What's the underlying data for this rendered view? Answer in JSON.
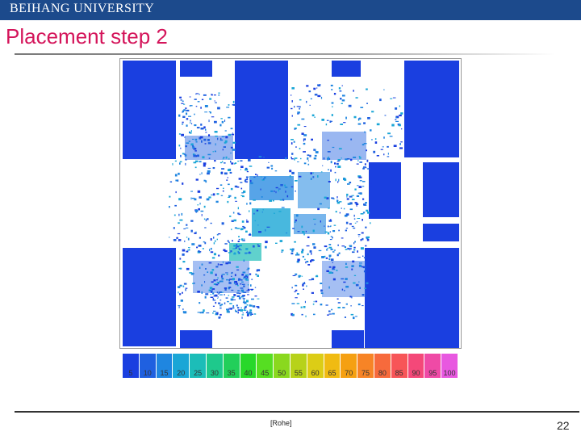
{
  "header": {
    "university": "BEIHANG UNIVERSITY",
    "bar_color": "#1c4a8c"
  },
  "slide": {
    "title": "Placement step 2",
    "title_color": "#d4145a"
  },
  "colorbar": {
    "labels": [
      "5",
      "10",
      "15",
      "20",
      "25",
      "30",
      "35",
      "40",
      "45",
      "50",
      "55",
      "60",
      "65",
      "70",
      "75",
      "80",
      "85",
      "90",
      "95",
      "100"
    ],
    "colors": [
      "#1a3fe0",
      "#1f60e0",
      "#1f86e0",
      "#1aa6d6",
      "#1cbdb8",
      "#1ec98c",
      "#22cf5a",
      "#28d82a",
      "#56de22",
      "#8ad81e",
      "#b7d21a",
      "#dccd16",
      "#f0bb12",
      "#f5a012",
      "#f78426",
      "#f76a3c",
      "#f75558",
      "#f44879",
      "#ef4aa6",
      "#e858e0"
    ]
  },
  "footer": {
    "citation": "[Rohe]",
    "page_number": "22"
  }
}
